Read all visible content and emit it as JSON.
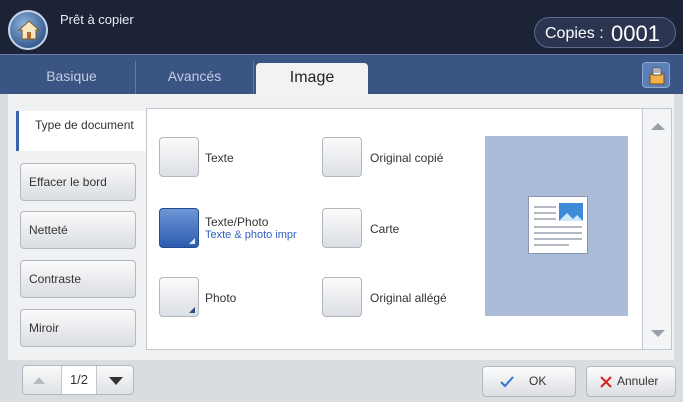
{
  "header": {
    "title": "Prêt à copier",
    "copies_label": "Copies :",
    "copies_value": "0001"
  },
  "tabs": [
    {
      "label": "Basique"
    },
    {
      "label": "Avancés"
    },
    {
      "label": "Image"
    }
  ],
  "sidebar": {
    "items": [
      {
        "label": "Type de document"
      },
      {
        "label": "Effacer le bord"
      },
      {
        "label": "Netteté"
      },
      {
        "label": "Contraste"
      },
      {
        "label": "Miroir"
      }
    ]
  },
  "options": [
    {
      "label": "Texte",
      "selected": false
    },
    {
      "label": "Texte/Photo",
      "sublabel": "Texte & photo impr",
      "selected": true
    },
    {
      "label": "Photo",
      "selected": false
    },
    {
      "label": "Original copié",
      "selected": false
    },
    {
      "label": "Carte",
      "selected": false
    },
    {
      "label": "Original allégé",
      "selected": false
    }
  ],
  "pager": {
    "value": "1/2"
  },
  "footer": {
    "ok_label": "OK",
    "cancel_label": "Annuler"
  },
  "colors": {
    "header_bg": "#1c2336",
    "tabbar_bg": "#3a5484",
    "selected_blue": "#2d5bb0",
    "cancel_x": "#d62020",
    "ok_check": "#3a70d0"
  },
  "icons": [
    "home-icon",
    "job-status-icon",
    "scroll-up-icon",
    "scroll-down-icon",
    "check-icon",
    "close-icon"
  ]
}
